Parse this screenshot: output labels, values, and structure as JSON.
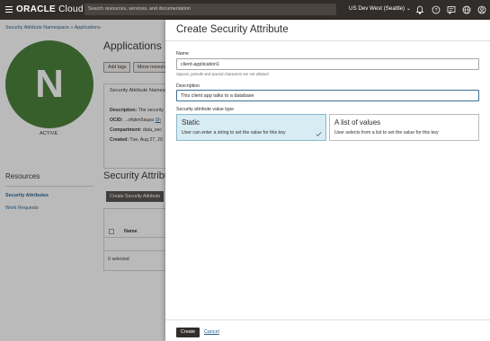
{
  "topbar": {
    "logo_brand": "ORACLE",
    "logo_product": "Cloud",
    "search_placeholder": "Search resources, services, and documentation",
    "region": "US Dev West (Seattle)",
    "icons": [
      "menu-icon",
      "bell-icon",
      "help-icon",
      "chat-icon",
      "globe-icon",
      "user-icon"
    ]
  },
  "background": {
    "breadcrumb": "Security Attribute Namespace » Applications",
    "avatar_letter": "N",
    "avatar_color": "#3f7a2f",
    "status": "ACTIVE",
    "page_title": "Applications",
    "buttons": {
      "add_tags": "Add tags",
      "move_resource": "Move resource"
    },
    "info_heading": "Security Attribute Namespace",
    "info": {
      "description_label": "Description:",
      "description_value": "The security",
      "ocid_label": "OCID:",
      "ocid_value": "...ofqkm5aupa",
      "ocid_show": "Sh",
      "compartment_label": "Compartment:",
      "compartment_value": "data_sec",
      "created_label": "Created:",
      "created_value": "Tue, Aug 27, 20"
    },
    "resources_title": "Resources",
    "resources": [
      "Security Attributes",
      "Work Requests"
    ],
    "section_title": "Security Attributes",
    "create_button": "Create Security Attribute",
    "table_col_name": "Name",
    "table_footer": "0 selected"
  },
  "drawer": {
    "title": "Create Security Attribute",
    "name_label": "Name",
    "name_value": "client-application1",
    "name_hint": "Spaces, periods and special characters are not allowed",
    "description_label": "Description",
    "description_value": "This client app talks to a database",
    "type_label": "Security attribute value type",
    "options": [
      {
        "title": "Static",
        "desc": "User can enter a string to set the value for this key",
        "selected": true
      },
      {
        "title": "A list of values",
        "desc": "User selects from a list to set the value for this key",
        "selected": false
      }
    ],
    "create_label": "Create",
    "cancel_label": "Cancel"
  }
}
